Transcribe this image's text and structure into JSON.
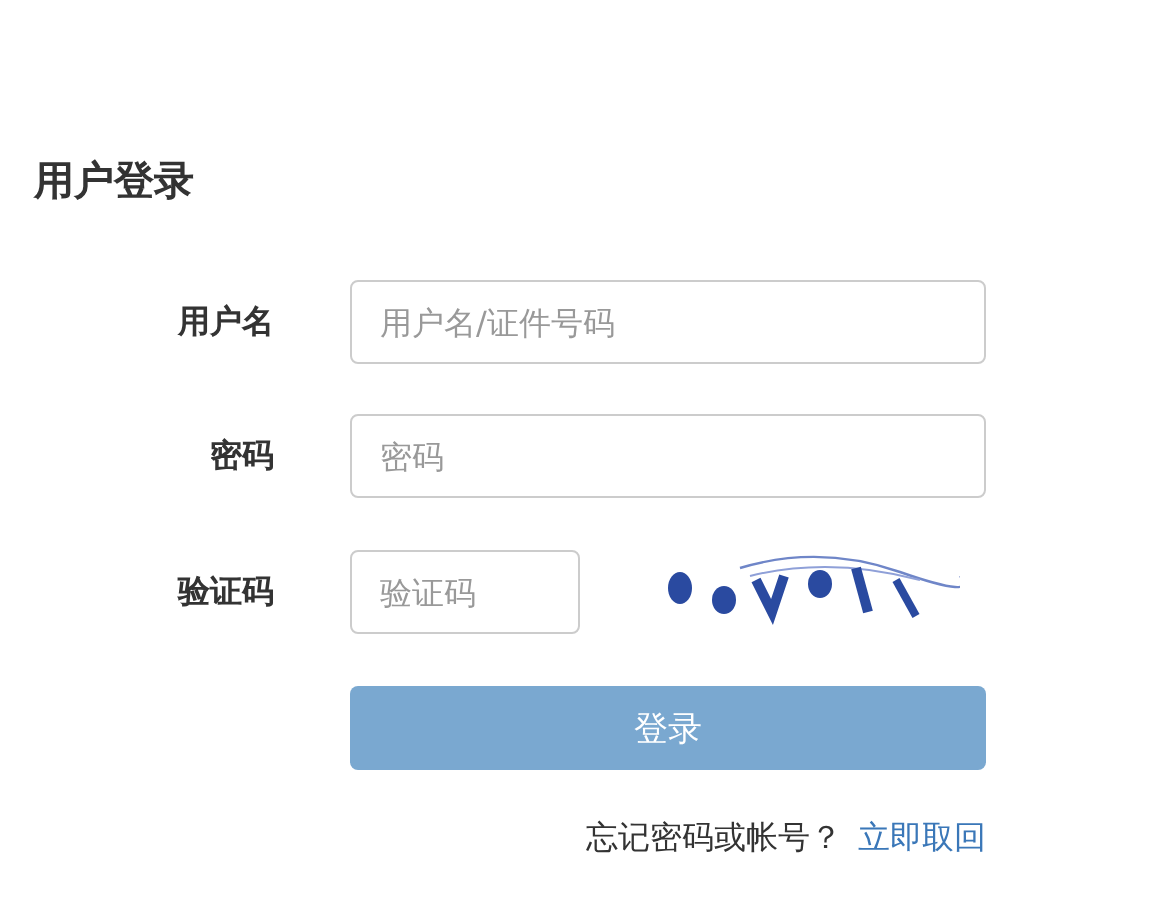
{
  "title": "用户登录",
  "fields": [
    {
      "kind": "text",
      "label": "用户名",
      "placeholder": "用户名/证件号码"
    },
    {
      "kind": "text",
      "label": "密码",
      "placeholder": "密码"
    },
    {
      "kind": "captcha",
      "label": "验证码",
      "placeholder": "验证码"
    }
  ],
  "submit": "登录",
  "forgot": {
    "text": "忘记密码或帐号？",
    "link": "立即取回"
  }
}
